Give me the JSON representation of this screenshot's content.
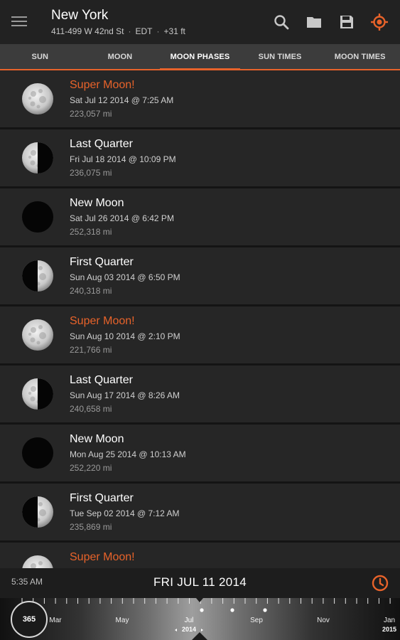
{
  "header": {
    "title": "New York",
    "address": "411-499 W 42nd St",
    "timezone": "EDT",
    "elevation": "+31 ft",
    "accent": "#e8632a"
  },
  "tabs": [
    {
      "label": "SUN"
    },
    {
      "label": "MOON"
    },
    {
      "label": "MOON PHASES",
      "active": true
    },
    {
      "label": "SUN TIMES"
    },
    {
      "label": "MOON TIMES"
    }
  ],
  "phases": [
    {
      "name": "Super Moon!",
      "super": true,
      "phase": "full",
      "date": "Sat Jul 12 2014 @ 7:25 AM",
      "distance": "223,057 mi"
    },
    {
      "name": "Last Quarter",
      "super": false,
      "phase": "last-quarter",
      "date": "Fri Jul 18 2014 @ 10:09 PM",
      "distance": "236,075 mi"
    },
    {
      "name": "New Moon",
      "super": false,
      "phase": "new",
      "date": "Sat Jul 26 2014 @ 6:42 PM",
      "distance": "252,318 mi"
    },
    {
      "name": "First Quarter",
      "super": false,
      "phase": "first-quarter",
      "date": "Sun Aug 03 2014 @ 6:50 PM",
      "distance": "240,318 mi"
    },
    {
      "name": "Super Moon!",
      "super": true,
      "phase": "full",
      "date": "Sun Aug 10 2014 @ 2:10 PM",
      "distance": "221,766 mi"
    },
    {
      "name": "Last Quarter",
      "super": false,
      "phase": "last-quarter",
      "date": "Sun Aug 17 2014 @ 8:26 AM",
      "distance": "240,658 mi"
    },
    {
      "name": "New Moon",
      "super": false,
      "phase": "new",
      "date": "Mon Aug 25 2014 @ 10:13 AM",
      "distance": "252,220 mi"
    },
    {
      "name": "First Quarter",
      "super": false,
      "phase": "first-quarter",
      "date": "Tue Sep 02 2014 @ 7:12 AM",
      "distance": "235,869 mi"
    },
    {
      "name": "Super Moon!",
      "super": true,
      "phase": "full",
      "date": "",
      "distance": ""
    }
  ],
  "datebar": {
    "time": "5:35 AM",
    "date": "FRI JUL 11 2014"
  },
  "timeline": {
    "badge": "365",
    "months": [
      "Mar",
      "May",
      "Jul",
      "Sep",
      "Nov",
      "Jan"
    ],
    "year": "2014",
    "next_year": "2015"
  }
}
